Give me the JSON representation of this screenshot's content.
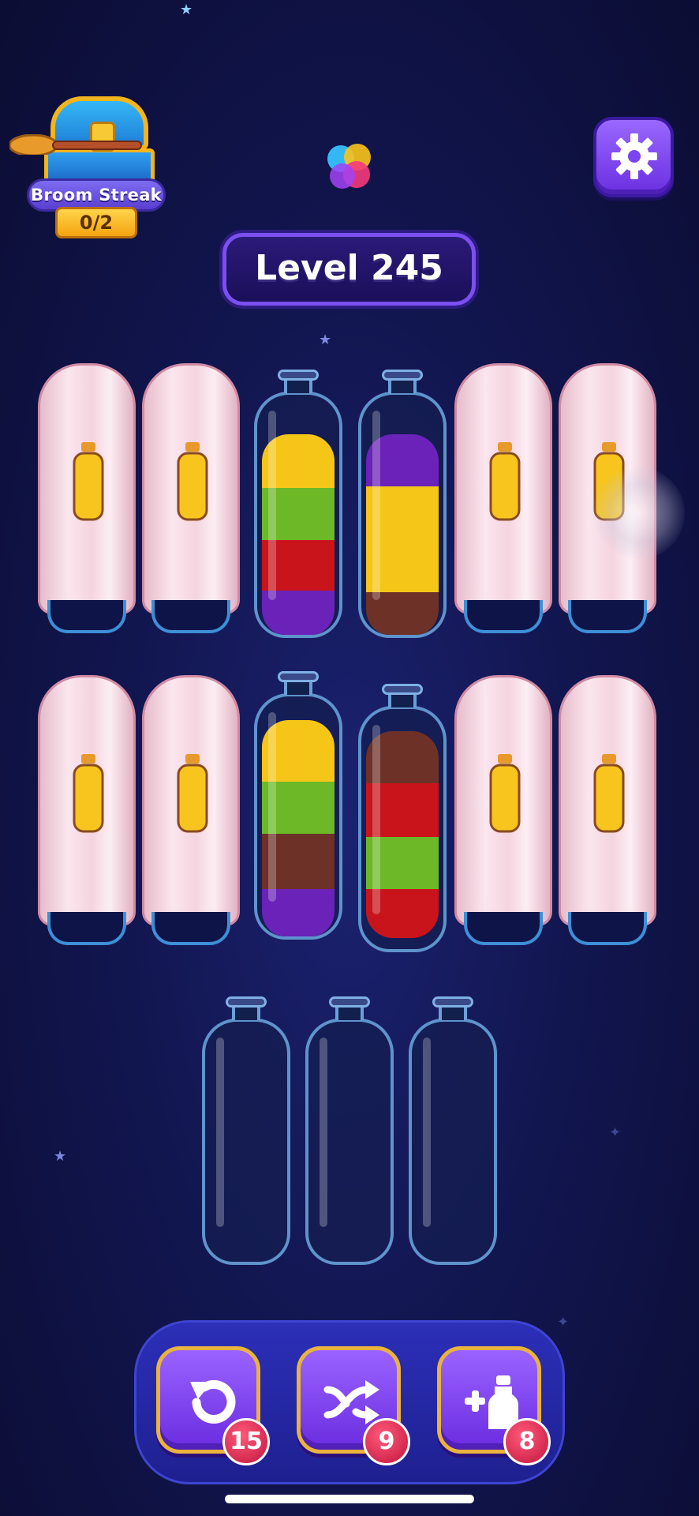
{
  "header": {
    "streak_label": "Broom Streak",
    "streak_count": "0/2",
    "level_label": "Level 245"
  },
  "boosters": [
    {
      "name": "undo",
      "count": "15"
    },
    {
      "name": "shuffle",
      "count": "9"
    },
    {
      "name": "add-bottle",
      "count": "8"
    }
  ],
  "colors": {
    "yellow": "#f5c617",
    "green": "#6cb827",
    "red": "#c9141c",
    "purple": "#6a22b8",
    "brown": "#6e3128",
    "accent": "#7b4ff0",
    "badge": "#d21f4a"
  },
  "board": {
    "row1": [
      {
        "state": "covered"
      },
      {
        "state": "covered"
      },
      {
        "state": "open",
        "layers_top_to_bottom": [
          "yellow",
          "green",
          "red",
          "purple"
        ]
      },
      {
        "state": "open",
        "layers_top_to_bottom": [
          "purple",
          "yellow",
          "yellow",
          "brown"
        ]
      },
      {
        "state": "covered"
      },
      {
        "state": "covered"
      }
    ],
    "row2": [
      {
        "state": "covered"
      },
      {
        "state": "covered"
      },
      {
        "state": "open",
        "layers_top_to_bottom": [
          "yellow",
          "green",
          "brown",
          "purple"
        ]
      },
      {
        "state": "open",
        "layers_top_to_bottom": [
          "brown",
          "red",
          "green",
          "red"
        ]
      },
      {
        "state": "covered"
      },
      {
        "state": "covered"
      }
    ],
    "row3": [
      {
        "state": "empty"
      },
      {
        "state": "empty"
      },
      {
        "state": "empty"
      }
    ]
  }
}
